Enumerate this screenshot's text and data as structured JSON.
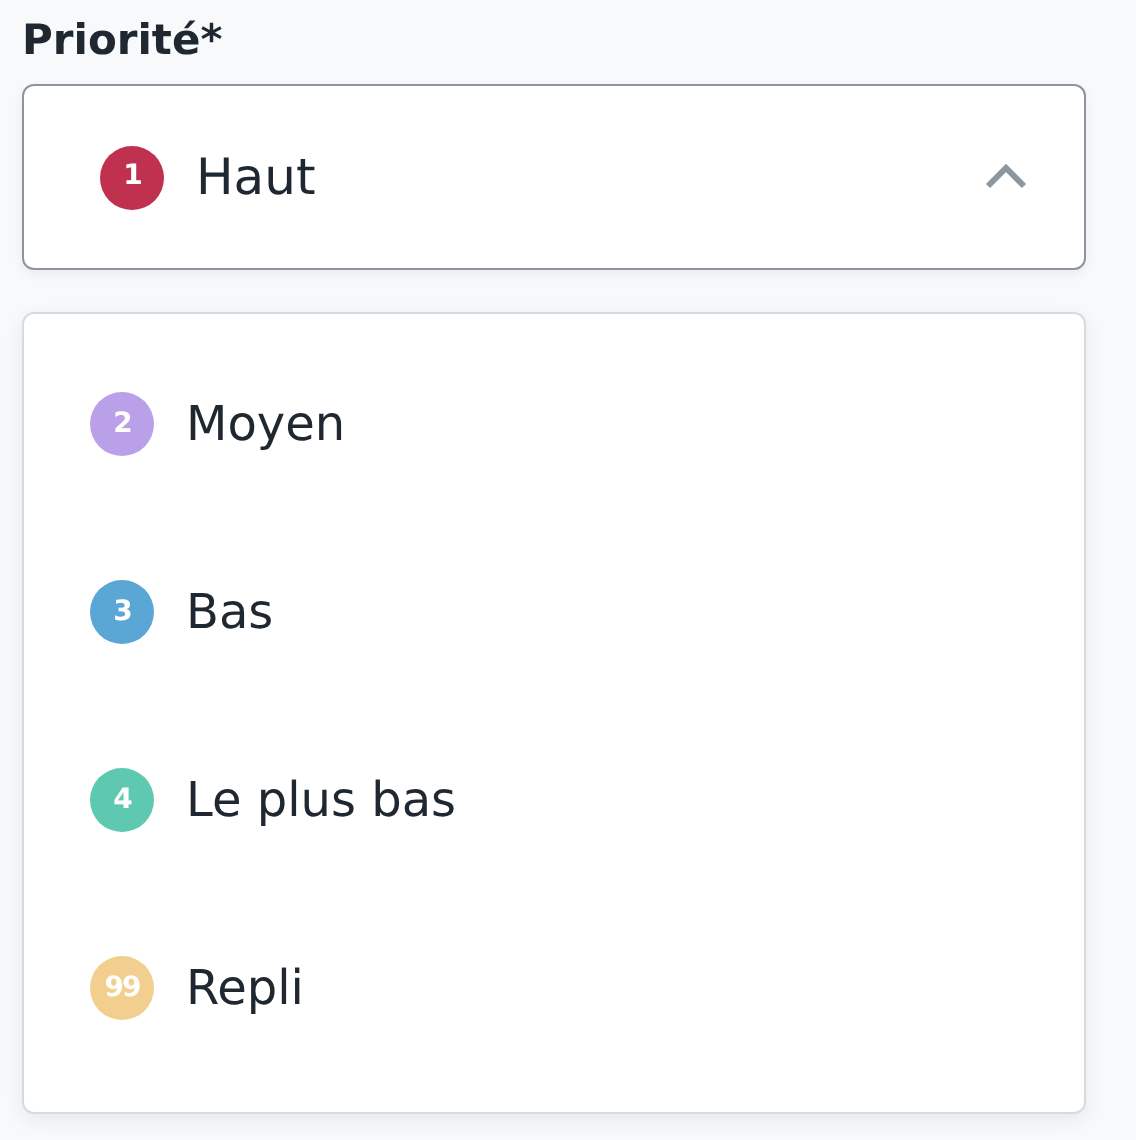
{
  "field": {
    "label": "Priorité*",
    "expanded": true,
    "value": {
      "badge": "1",
      "label": "Haut",
      "color": "#c0304f"
    }
  },
  "options": [
    {
      "badge": "2",
      "label": "Moyen",
      "color": "#b9a0e8",
      "selected": false
    },
    {
      "badge": "3",
      "label": "Bas",
      "color": "#5aa7d6",
      "selected": false
    },
    {
      "badge": "4",
      "label": "Le plus bas",
      "color": "#5ec8b0",
      "selected": false
    },
    {
      "badge": "99",
      "label": "Repli",
      "color": "#f2cf8e",
      "selected": false
    }
  ]
}
